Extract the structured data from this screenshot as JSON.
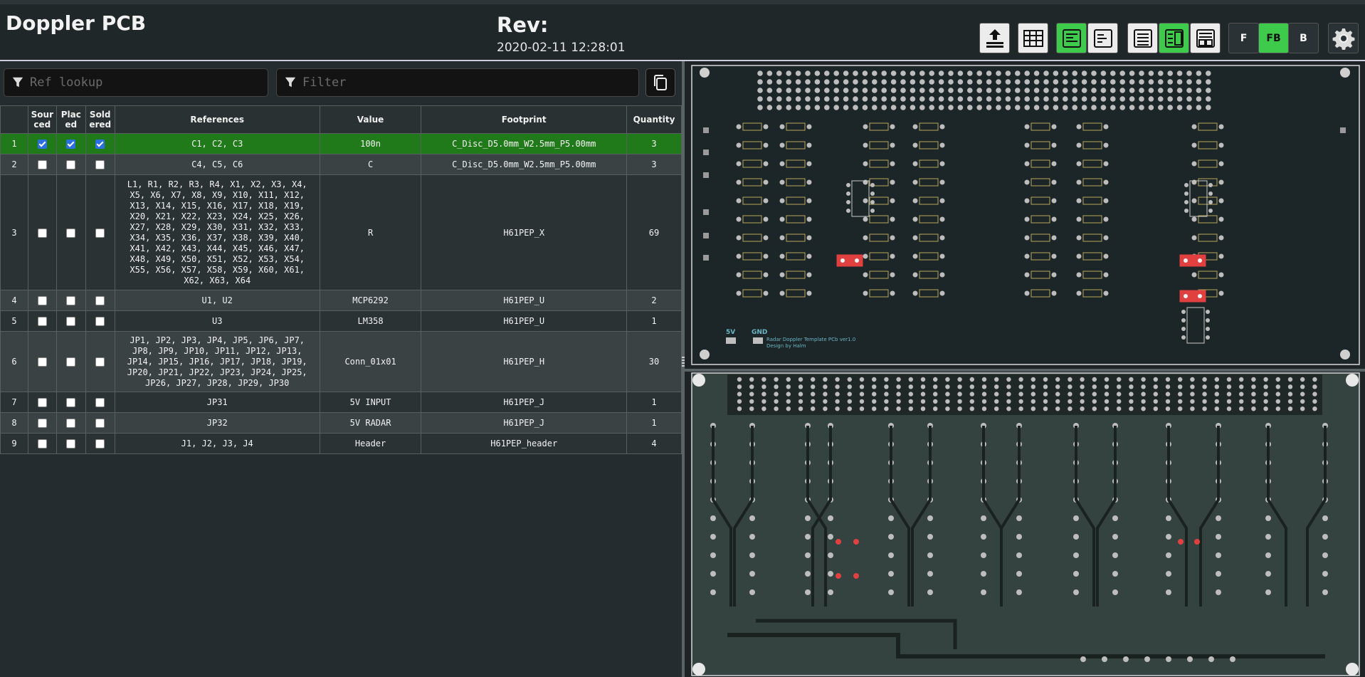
{
  "header": {
    "title": "Doppler PCB",
    "rev_label": "Rev:",
    "rev_date": "2020-02-11 12:28:01"
  },
  "toolbar": {
    "icons": [
      "upload-icon",
      "grid-icon",
      "bom-left-right-icon",
      "bom-top-bottom-icon",
      "bom-only-icon",
      "bom-front-back-icon",
      "bom-fb-icon"
    ],
    "layer_front_label": "F",
    "layer_both_label": "FB",
    "layer_back_label": "B",
    "active_layer": "FB",
    "accent_color": "#3ecb4b"
  },
  "search": {
    "ref_placeholder": "Ref lookup",
    "filter_placeholder": "Filter"
  },
  "table": {
    "headers": [
      "",
      "Sour ced",
      "Plac ed",
      "Sold ered",
      "References",
      "Value",
      "Footprint",
      "Quantity"
    ],
    "rows": [
      {
        "n": "1",
        "sourced": true,
        "placed": true,
        "soldered": true,
        "refs": "C1, C2, C3",
        "value": "100n",
        "footprint": "C_Disc_D5.0mm_W2.5mm_P5.00mm",
        "qty": "3"
      },
      {
        "n": "2",
        "sourced": false,
        "placed": false,
        "soldered": false,
        "refs": "C4, C5, C6",
        "value": "C",
        "footprint": "C_Disc_D5.0mm_W2.5mm_P5.00mm",
        "qty": "3"
      },
      {
        "n": "3",
        "sourced": false,
        "placed": false,
        "soldered": false,
        "refs": "L1, R1, R2, R3, R4, X1, X2, X3, X4, X5, X6, X7, X8, X9, X10, X11, X12, X13, X14, X15, X16, X17, X18, X19, X20, X21, X22, X23, X24, X25, X26, X27, X28, X29, X30, X31, X32, X33, X34, X35, X36, X37, X38, X39, X40, X41, X42, X43, X44, X45, X46, X47, X48, X49, X50, X51, X52, X53, X54, X55, X56, X57, X58, X59, X60, X61, X62, X63, X64",
        "value": "R",
        "footprint": "H61PEP_X",
        "qty": "69"
      },
      {
        "n": "4",
        "sourced": false,
        "placed": false,
        "soldered": false,
        "refs": "U1, U2",
        "value": "MCP6292",
        "footprint": "H61PEP_U",
        "qty": "2"
      },
      {
        "n": "5",
        "sourced": false,
        "placed": false,
        "soldered": false,
        "refs": "U3",
        "value": "LM358",
        "footprint": "H61PEP_U",
        "qty": "1"
      },
      {
        "n": "6",
        "sourced": false,
        "placed": false,
        "soldered": false,
        "refs": "JP1, JP2, JP3, JP4, JP5, JP6, JP7, JP8, JP9, JP10, JP11, JP12, JP13, JP14, JP15, JP16, JP17, JP18, JP19, JP20, JP21, JP22, JP23, JP24, JP25, JP26, JP27, JP28, JP29, JP30",
        "value": "Conn_01x01",
        "footprint": "H61PEP_H",
        "qty": "30"
      },
      {
        "n": "7",
        "sourced": false,
        "placed": false,
        "soldered": false,
        "refs": "JP31",
        "value": "5V INPUT",
        "footprint": "H61PEP_J",
        "qty": "1"
      },
      {
        "n": "8",
        "sourced": false,
        "placed": false,
        "soldered": false,
        "refs": "JP32",
        "value": "5V RADAR",
        "footprint": "H61PEP_J",
        "qty": "1"
      },
      {
        "n": "9",
        "sourced": false,
        "placed": false,
        "soldered": false,
        "refs": "J1, J2, J3, J4",
        "value": "Header",
        "footprint": "H61PEP_header",
        "qty": "4"
      }
    ]
  },
  "pcb": {
    "silkscreen_credit_1": "Radar Doppler Template PCb ver1.0",
    "silkscreen_credit_2": "Design by Halm",
    "label_5v": "5V",
    "label_gnd": "GND",
    "highlight_color": "#e04040"
  }
}
